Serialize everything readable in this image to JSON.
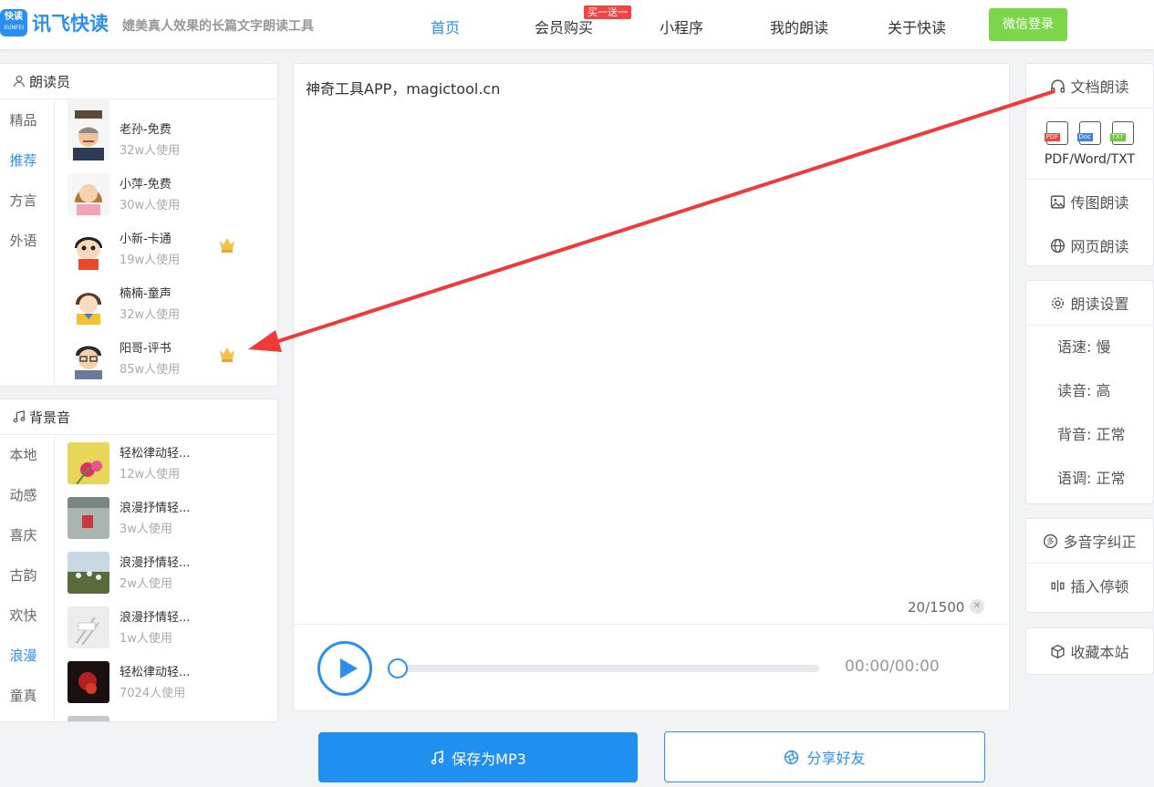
{
  "header": {
    "logo_badge": "快读",
    "logo_badge_sub": "XUNFEI",
    "app_name": "讯飞快读",
    "slogan": "媲美真人效果的长篇文字朗读工具",
    "nav": [
      "首页",
      "会员购买",
      "小程序",
      "我的朗读",
      "关于快读"
    ],
    "promo_badge": "买一送一",
    "login": "微信登录"
  },
  "readers": {
    "title": "朗读员",
    "categories": [
      "精品",
      "推荐",
      "方言",
      "外语"
    ],
    "active_category": "推荐",
    "items": [
      {
        "name": "老孙-免费",
        "uses": "32w人使用",
        "vip": false
      },
      {
        "name": "小萍-免费",
        "uses": "30w人使用",
        "vip": false
      },
      {
        "name": "小新-卡通",
        "uses": "19w人使用",
        "vip": true
      },
      {
        "name": "楠楠-童声",
        "uses": "32w人使用",
        "vip": false
      },
      {
        "name": "阳哥-评书",
        "uses": "85w人使用",
        "vip": true
      }
    ]
  },
  "bgm": {
    "title": "背景音",
    "categories": [
      "本地",
      "动感",
      "喜庆",
      "古韵",
      "欢快",
      "浪漫",
      "童真"
    ],
    "active_category": "浪漫",
    "items": [
      {
        "name": "轻松律动轻...",
        "uses": "12w人使用"
      },
      {
        "name": "浪漫抒情轻...",
        "uses": "3w人使用"
      },
      {
        "name": "浪漫抒情轻...",
        "uses": "2w人使用"
      },
      {
        "name": "浪漫抒情轻...",
        "uses": "1w人使用"
      },
      {
        "name": "轻松律动轻...",
        "uses": "7024人使用"
      }
    ]
  },
  "editor": {
    "text": "神奇工具APP，magictool.cn",
    "counter": "20/1500",
    "time": "00:00/00:00",
    "progress": 0
  },
  "actions": {
    "save": "保存为MP3",
    "share": "分享好友"
  },
  "right": {
    "doc_read": "文档朗读",
    "doc_types": [
      "PDF",
      "Doc",
      "TXT"
    ],
    "doc_caption": "PDF/Word/TXT",
    "image_read": "传图朗读",
    "web_read": "网页朗读",
    "settings_title": "朗读设置",
    "settings": [
      "语速: 慢",
      "读音: 高",
      "背音: 正常",
      "语调: 正常"
    ],
    "polyphone": "多音字纠正",
    "insert_pause": "插入停顿",
    "bookmark": "收藏本站"
  },
  "colors": {
    "accent": "#2b8ff0",
    "login": "#7cd64a",
    "promo": "#f04545",
    "arrow": "#f03a3a"
  }
}
